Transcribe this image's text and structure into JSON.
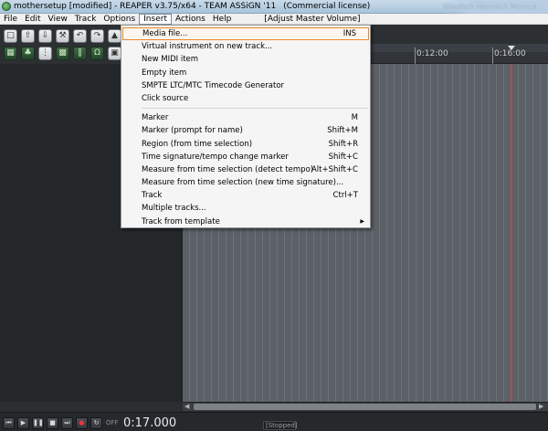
{
  "titlebar": {
    "title": "mothersetup [modified] - REAPER v3.75/x64 - TEAM ASSiGN '11",
    "license": "(Commercial license)",
    "background_window_text": "Wiedlich Heimlich Monica ..."
  },
  "menubar": {
    "items": [
      {
        "label": "File"
      },
      {
        "label": "Edit"
      },
      {
        "label": "View"
      },
      {
        "label": "Track"
      },
      {
        "label": "Options"
      },
      {
        "label": "Insert"
      },
      {
        "label": "Actions"
      },
      {
        "label": "Help"
      }
    ],
    "active": "Insert",
    "master_volume_label": "[Adjust Master Volume]"
  },
  "toolbar": {
    "row1_icons": [
      "new-project-icon",
      "open-project-icon",
      "save-project-icon",
      "settings-icon",
      "undo-icon",
      "redo-icon",
      "metronome-icon"
    ],
    "row2_icons": [
      "grid-icon",
      "envelope-icon",
      "grid-snap-icon",
      "ripple-edit-icon",
      "item-grouping-icon",
      "midi-icon",
      "lock-icon"
    ]
  },
  "ruler": {
    "labels": [
      "0:12:00",
      "0:16:00"
    ]
  },
  "insert_menu": {
    "items": [
      {
        "label": "Media file...",
        "shortcut": "INS",
        "highlighted": true
      },
      {
        "label": "Virtual instrument on new track...",
        "shortcut": ""
      },
      {
        "label": "New MIDI item",
        "shortcut": ""
      },
      {
        "label": "Empty item",
        "shortcut": ""
      },
      {
        "label": "SMPTE LTC/MTC Timecode Generator",
        "shortcut": ""
      },
      {
        "label": "Click source",
        "shortcut": ""
      },
      {
        "separator": true
      },
      {
        "label": "Marker",
        "shortcut": "M"
      },
      {
        "label": "Marker (prompt for name)",
        "shortcut": "Shift+M"
      },
      {
        "label": "Region (from time selection)",
        "shortcut": "Shift+R"
      },
      {
        "label": "Time signature/tempo change marker",
        "shortcut": "Shift+C"
      },
      {
        "label": "Measure from time selection (detect tempo)",
        "shortcut": "Alt+Shift+C"
      },
      {
        "label": "Measure from time selection (new time signature)...",
        "shortcut": ""
      },
      {
        "label": "Track",
        "shortcut": "Ctrl+T"
      },
      {
        "label": "Multiple tracks...",
        "shortcut": ""
      },
      {
        "label": "Track from template",
        "shortcut": "",
        "submenu": true
      }
    ]
  },
  "transport": {
    "buttons": [
      "play-icon",
      "pause-icon",
      "stop-icon",
      "goto-start-icon",
      "goto-end-icon",
      "record-icon",
      "repeat-icon"
    ],
    "off_label": "OFF",
    "time": "0:17.000",
    "status": "[Stopped]"
  }
}
